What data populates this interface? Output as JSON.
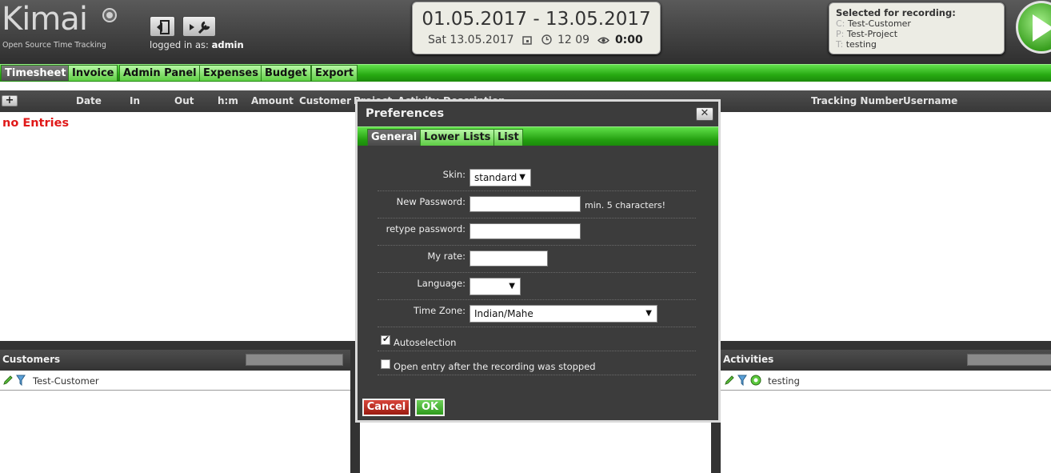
{
  "header": {
    "logo": "Kimai",
    "logo_subtitle": "Open Source Time Tracking",
    "logged_in_label": "logged in as:",
    "logged_in_user": "admin",
    "date_range": "01.05.2017 - 13.05.2017",
    "today": "Sat 13.05.2017",
    "time": "12 09",
    "timer": "0:00"
  },
  "recording": {
    "title": "Selected for recording:",
    "customer_key": "C:",
    "customer": "Test-Customer",
    "project_key": "P:",
    "project": "Test-Project",
    "task_key": "T:",
    "task": "testing"
  },
  "tabs": [
    "Timesheet",
    "Invoice",
    "Admin Panel",
    "Expenses",
    "Budget",
    "Export"
  ],
  "columns": {
    "date": "Date",
    "in": "In",
    "out": "Out",
    "hm": "h:m",
    "amount": "Amount",
    "customer": "Customer",
    "project": "Project",
    "activity": "Activity",
    "description": "Description",
    "tracking": "Tracking Number",
    "username": "Username"
  },
  "no_entries": "no Entries",
  "customers_panel": {
    "title": "Customers",
    "item": "Test-Customer"
  },
  "activities_panel": {
    "title": "Activities",
    "item": "testing"
  },
  "dialog": {
    "title": "Preferences",
    "close": "✕",
    "tabs": [
      "General",
      "Lower Lists",
      "List"
    ],
    "skin_label": "Skin:",
    "skin_value": "standard",
    "new_password_label": "New Password:",
    "new_password_hint": "min. 5 characters!",
    "retype_label": "retype password:",
    "rate_label": "My rate:",
    "language_label": "Language:",
    "language_value": "",
    "timezone_label": "Time Zone:",
    "timezone_value": "Indian/Mahe",
    "autoselection_label": "Autoselection",
    "open_entry_label": "Open entry after the recording was stopped",
    "cancel": "Cancel",
    "ok": "OK"
  },
  "colors": {
    "accent_green": "#27a912",
    "cancel_red": "#b02a1e",
    "no_entries_red": "#e01818"
  }
}
